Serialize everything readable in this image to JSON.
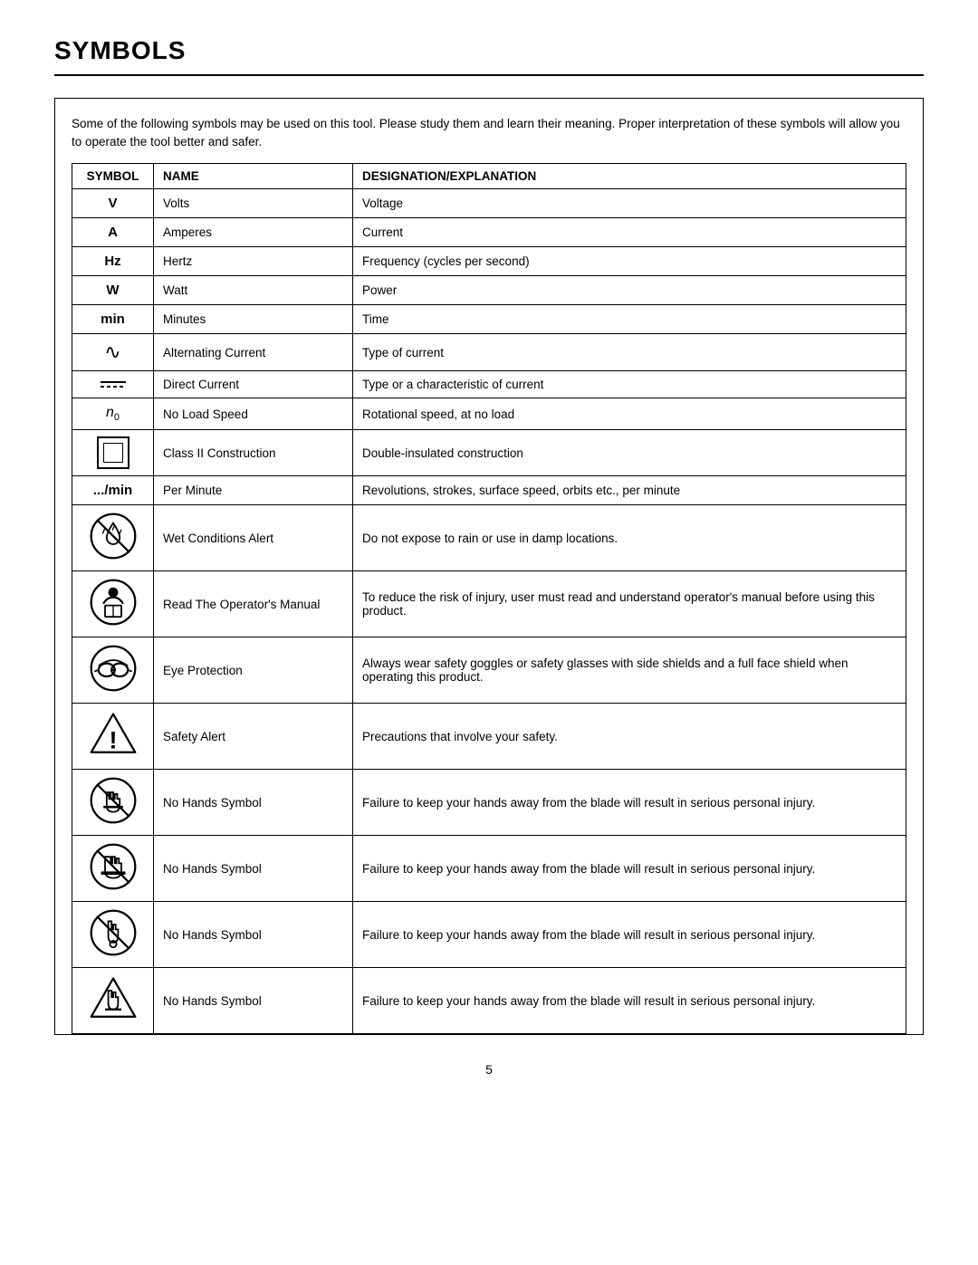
{
  "page": {
    "title": "SYMBOLS",
    "page_number": "5",
    "intro": "Some of the following symbols may be used on this tool. Please study them and learn their meaning. Proper interpretation of these symbols will allow you to operate the tool better and safer.",
    "table": {
      "headers": [
        "SYMBOL",
        "NAME",
        "DESIGNATION/EXPLANATION"
      ],
      "rows": [
        {
          "symbol": "V",
          "name": "Volts",
          "explanation": "Voltage",
          "icon_type": "text"
        },
        {
          "symbol": "A",
          "name": "Amperes",
          "explanation": "Current",
          "icon_type": "text"
        },
        {
          "symbol": "Hz",
          "name": "Hertz",
          "explanation": "Frequency (cycles per second)",
          "icon_type": "text"
        },
        {
          "symbol": "W",
          "name": "Watt",
          "explanation": "Power",
          "icon_type": "text"
        },
        {
          "symbol": "min",
          "name": "Minutes",
          "explanation": "Time",
          "icon_type": "text"
        },
        {
          "symbol": "ac",
          "name": "Alternating Current",
          "explanation": "Type of current",
          "icon_type": "ac"
        },
        {
          "symbol": "dc",
          "name": "Direct Current",
          "explanation": "Type or a characteristic of current",
          "icon_type": "dc"
        },
        {
          "symbol": "n0",
          "name": "No Load Speed",
          "explanation": "Rotational speed, at no load",
          "icon_type": "n0"
        },
        {
          "symbol": "class2",
          "name": "Class II Construction",
          "explanation": "Double-insulated construction",
          "icon_type": "class2"
        },
        {
          "symbol": ".../min",
          "name": "Per Minute",
          "explanation": "Revolutions, strokes, surface speed, orbits etc., per minute",
          "icon_type": "text"
        },
        {
          "symbol": "wet",
          "name": "Wet Conditions Alert",
          "explanation": "Do not expose to rain or use in damp locations.",
          "icon_type": "wet"
        },
        {
          "symbol": "manual",
          "name": "Read The Operator's Manual",
          "explanation": "To reduce the risk of injury, user must read and understand operator's manual before using this product.",
          "icon_type": "manual"
        },
        {
          "symbol": "eye",
          "name": "Eye Protection",
          "explanation": "Always wear safety goggles or safety glasses with side shields and a full face shield when operating this product.",
          "icon_type": "eye"
        },
        {
          "symbol": "safety",
          "name": "Safety Alert",
          "explanation": "Precautions that involve your safety.",
          "icon_type": "safety"
        },
        {
          "symbol": "nohands1",
          "name": "No Hands Symbol",
          "explanation": "Failure to keep your hands away from the blade will result in serious personal injury.",
          "icon_type": "nohands1"
        },
        {
          "symbol": "nohands2",
          "name": "No Hands Symbol",
          "explanation": "Failure to keep your hands away from the blade will result in serious personal injury.",
          "icon_type": "nohands2"
        },
        {
          "symbol": "nohands3",
          "name": "No Hands Symbol",
          "explanation": "Failure to keep your hands away from the blade will result in serious personal injury.",
          "icon_type": "nohands3"
        },
        {
          "symbol": "nohands4",
          "name": "No Hands Symbol",
          "explanation": "Failure to keep your hands away from the blade will result in serious personal injury.",
          "icon_type": "nohands4"
        }
      ]
    }
  }
}
